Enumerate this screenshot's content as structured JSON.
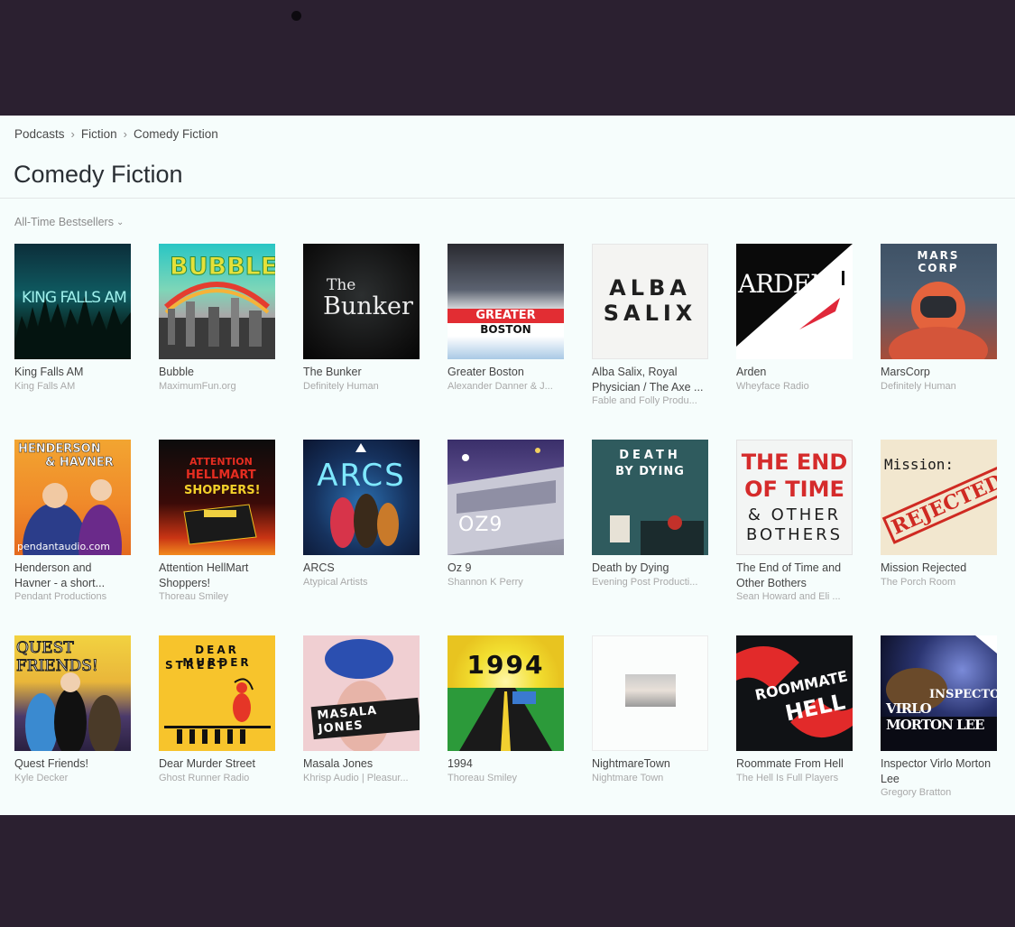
{
  "breadcrumb": [
    "Podcasts",
    "Fiction",
    "Comedy Fiction"
  ],
  "page_title": "Comedy Fiction",
  "filter_label": "All-Time Bestsellers",
  "art_text": {
    "king_falls": "KING FALLS AM",
    "bubble": "BUBBLE",
    "bunker_1": "The",
    "bunker_2": "Bunker",
    "gb_1": "GREATER",
    "gb_2": "BOSTON",
    "alba_1": "ALBA",
    "alba_2": "SALIX",
    "arden": "ARDEN",
    "mars": "MARS CORP",
    "hh_1": "HENDERSON",
    "hh_2": "& HAVNER",
    "hh_3": "pendantaudio.com",
    "hm_1": "ATTENTION",
    "hm_2": "HELLMART",
    "hm_3": "SHOPPERS!",
    "arcs": "ARCS",
    "oz": "OZ9",
    "dbd_1": "DEATH",
    "dbd_2": "BY DYING",
    "eot_1": "THE END",
    "eot_2": "OF TIME",
    "eot_3": "& OTHER",
    "eot_4": "BOTHERS",
    "mr_1": "Mission:",
    "mr_2": "REJECTED",
    "qf": "QUEST FRIENDS!",
    "dms_1": "DEAR MURDER",
    "dms_2": "STREET",
    "masala": "MASALA JONES",
    "y1994": "1994",
    "rm_1": "ROOMMATE",
    "rm_2": "HELL",
    "iv_1": "INSPECTOR",
    "iv_2": "VIRLO MORTON LEE"
  },
  "podcasts": [
    {
      "title": "King Falls AM",
      "author": "King Falls AM"
    },
    {
      "title": "Bubble",
      "author": "MaximumFun.org"
    },
    {
      "title": "The Bunker",
      "author": "Definitely Human"
    },
    {
      "title": "Greater Boston",
      "author": "Alexander Danner & J..."
    },
    {
      "title": "Alba Salix, Royal Physician / The Axe ...",
      "author": "Fable and Folly Produ..."
    },
    {
      "title": "Arden",
      "author": "Wheyface Radio"
    },
    {
      "title": "MarsCorp",
      "author": "Definitely Human"
    },
    {
      "title": "Henderson and Havner - a short...",
      "author": "Pendant Productions"
    },
    {
      "title": "Attention HellMart Shoppers!",
      "author": "Thoreau Smiley"
    },
    {
      "title": "ARCS",
      "author": "Atypical Artists"
    },
    {
      "title": "Oz 9",
      "author": "Shannon K Perry"
    },
    {
      "title": "Death by Dying",
      "author": "Evening Post Producti..."
    },
    {
      "title": "The End of Time and Other Bothers",
      "author": "Sean Howard and Eli ..."
    },
    {
      "title": "Mission Rejected",
      "author": "The Porch Room"
    },
    {
      "title": "Quest Friends!",
      "author": "Kyle Decker"
    },
    {
      "title": "Dear Murder Street",
      "author": "Ghost Runner Radio"
    },
    {
      "title": "Masala Jones",
      "author": "Khrisp Audio | Pleasur..."
    },
    {
      "title": "1994",
      "author": "Thoreau Smiley"
    },
    {
      "title": "NightmareTown",
      "author": "Nightmare Town"
    },
    {
      "title": "Roommate From Hell",
      "author": "The Hell Is Full Players"
    },
    {
      "title": "Inspector Virlo Morton Lee",
      "author": "Gregory Bratton"
    }
  ]
}
